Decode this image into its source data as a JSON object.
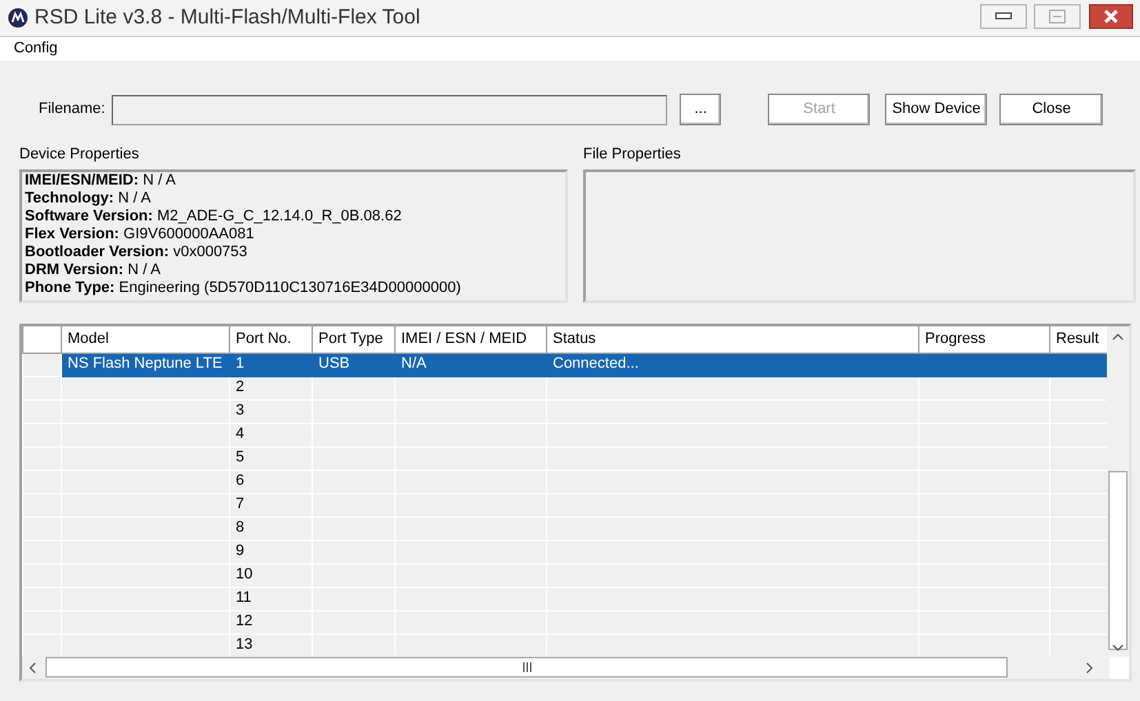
{
  "window": {
    "title": "RSD Lite v3.8 - Multi-Flash/Multi-Flex Tool"
  },
  "menu": [
    "Config"
  ],
  "filename": {
    "label": "Filename:",
    "disabled": true
  },
  "buttons": [
    {
      "label": "...",
      "disabled": false
    },
    {
      "label": "Start",
      "disabled": true
    },
    {
      "label": "Show Device",
      "disabled": false
    },
    {
      "label": "Close",
      "disabled": false
    }
  ],
  "device_properties": {
    "title": "Device Properties",
    "lines": [
      "**IMEI/ESN/MEID:** N / A",
      "**Technology:** N / A",
      "**Software Version:** M2_ADE-G_C_12.14.0_R_0B.08.62",
      "**Flex Version:** GI9V600000AA081",
      "**Bootloader Version:** v0x000753",
      "**DRM Version:** N / A",
      "**Phone Type:** Engineering (5D570D110C130716E34D00000000)"
    ]
  },
  "file_properties": {
    "title": "File Properties"
  },
  "table": {
    "columns": [
      "Model",
      "Port No.",
      "Port Type",
      "IMEI / ESN / MEID",
      "Status",
      "Progress",
      "Result"
    ],
    "rows": [
      {
        "model": "NS Flash Neptune LTE",
        "port": "1",
        "port_type": "USB",
        "imei": "N/A",
        "status": "Connected...",
        "selected": true
      },
      {
        "port": "2",
        "selected": false
      },
      {
        "port": "3",
        "selected": false
      },
      {
        "port": "4",
        "selected": false
      },
      {
        "port": "5",
        "selected": false
      },
      {
        "port": "6",
        "selected": false
      },
      {
        "port": "7",
        "selected": false
      },
      {
        "port": "8",
        "selected": false
      },
      {
        "port": "9",
        "selected": false
      },
      {
        "port": "10",
        "selected": false
      },
      {
        "port": "11",
        "selected": false
      },
      {
        "port": "12",
        "selected": false
      },
      {
        "port": "13",
        "selected": false
      }
    ]
  }
}
